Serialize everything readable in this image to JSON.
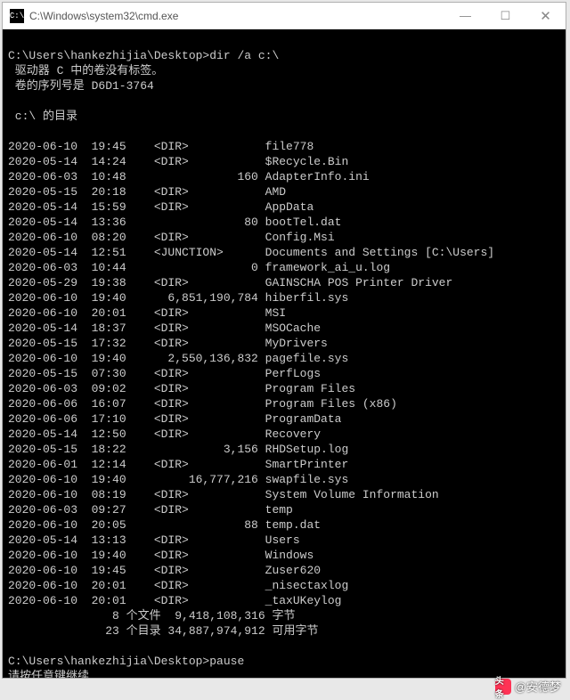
{
  "window": {
    "icon_label": "C:\\",
    "title": "C:\\Windows\\system32\\cmd.exe",
    "controls": {
      "min": "—",
      "max": "☐",
      "close": "✕"
    }
  },
  "prompt1": "C:\\Users\\hankezhijia\\Desktop>dir /a c:\\",
  "vol_no_label": " 驱动器 C 中的卷没有标签。",
  "vol_serial": " 卷的序列号是 D6D1-3764",
  "dir_of": " c:\\ 的目录",
  "entries": [
    {
      "date": "2020-06-10",
      "time": "19:45",
      "type": "<DIR>",
      "size": "",
      "name": "file778"
    },
    {
      "date": "2020-05-14",
      "time": "14:24",
      "type": "<DIR>",
      "size": "",
      "name": "$Recycle.Bin"
    },
    {
      "date": "2020-06-03",
      "time": "10:48",
      "type": "",
      "size": "160",
      "name": "AdapterInfo.ini"
    },
    {
      "date": "2020-05-15",
      "time": "20:18",
      "type": "<DIR>",
      "size": "",
      "name": "AMD"
    },
    {
      "date": "2020-05-14",
      "time": "15:59",
      "type": "<DIR>",
      "size": "",
      "name": "AppData"
    },
    {
      "date": "2020-05-14",
      "time": "13:36",
      "type": "",
      "size": "80",
      "name": "bootTel.dat"
    },
    {
      "date": "2020-06-10",
      "time": "08:20",
      "type": "<DIR>",
      "size": "",
      "name": "Config.Msi"
    },
    {
      "date": "2020-05-14",
      "time": "12:51",
      "type": "<JUNCTION>",
      "size": "",
      "name": "Documents and Settings [C:\\Users]"
    },
    {
      "date": "2020-06-03",
      "time": "10:44",
      "type": "",
      "size": "0",
      "name": "framework_ai_u.log"
    },
    {
      "date": "2020-05-29",
      "time": "19:38",
      "type": "<DIR>",
      "size": "",
      "name": "GAINSCHA POS Printer Driver"
    },
    {
      "date": "2020-06-10",
      "time": "19:40",
      "type": "",
      "size": "6,851,190,784",
      "name": "hiberfil.sys"
    },
    {
      "date": "2020-06-10",
      "time": "20:01",
      "type": "<DIR>",
      "size": "",
      "name": "MSI"
    },
    {
      "date": "2020-05-14",
      "time": "18:37",
      "type": "<DIR>",
      "size": "",
      "name": "MSOCache"
    },
    {
      "date": "2020-05-15",
      "time": "17:32",
      "type": "<DIR>",
      "size": "",
      "name": "MyDrivers"
    },
    {
      "date": "2020-06-10",
      "time": "19:40",
      "type": "",
      "size": "2,550,136,832",
      "name": "pagefile.sys"
    },
    {
      "date": "2020-05-15",
      "time": "07:30",
      "type": "<DIR>",
      "size": "",
      "name": "PerfLogs"
    },
    {
      "date": "2020-06-03",
      "time": "09:02",
      "type": "<DIR>",
      "size": "",
      "name": "Program Files"
    },
    {
      "date": "2020-06-06",
      "time": "16:07",
      "type": "<DIR>",
      "size": "",
      "name": "Program Files (x86)"
    },
    {
      "date": "2020-06-06",
      "time": "17:10",
      "type": "<DIR>",
      "size": "",
      "name": "ProgramData"
    },
    {
      "date": "2020-05-14",
      "time": "12:50",
      "type": "<DIR>",
      "size": "",
      "name": "Recovery"
    },
    {
      "date": "2020-05-15",
      "time": "18:22",
      "type": "",
      "size": "3,156",
      "name": "RHDSetup.log"
    },
    {
      "date": "2020-06-01",
      "time": "12:14",
      "type": "<DIR>",
      "size": "",
      "name": "SmartPrinter"
    },
    {
      "date": "2020-06-10",
      "time": "19:40",
      "type": "",
      "size": "16,777,216",
      "name": "swapfile.sys"
    },
    {
      "date": "2020-06-10",
      "time": "08:19",
      "type": "<DIR>",
      "size": "",
      "name": "System Volume Information"
    },
    {
      "date": "2020-06-03",
      "time": "09:27",
      "type": "<DIR>",
      "size": "",
      "name": "temp"
    },
    {
      "date": "2020-06-10",
      "time": "20:05",
      "type": "",
      "size": "88",
      "name": "temp.dat"
    },
    {
      "date": "2020-05-14",
      "time": "13:13",
      "type": "<DIR>",
      "size": "",
      "name": "Users"
    },
    {
      "date": "2020-06-10",
      "time": "19:40",
      "type": "<DIR>",
      "size": "",
      "name": "Windows"
    },
    {
      "date": "2020-06-10",
      "time": "19:45",
      "type": "<DIR>",
      "size": "",
      "name": "Zuser620"
    },
    {
      "date": "2020-06-10",
      "time": "20:01",
      "type": "<DIR>",
      "size": "",
      "name": "_nisectaxlog"
    },
    {
      "date": "2020-06-10",
      "time": "20:01",
      "type": "<DIR>",
      "size": "",
      "name": "_taxUKeylog"
    }
  ],
  "summary_files": "               8 个文件  9,418,108,316 字节",
  "summary_dirs": "              23 个目录 34,887,974,912 可用字节",
  "prompt2": "C:\\Users\\hankezhijia\\Desktop>pause",
  "pause_msg": "请按任意键继续. . . ",
  "watermark": {
    "icon": "头条",
    "text": "@安德梦"
  }
}
